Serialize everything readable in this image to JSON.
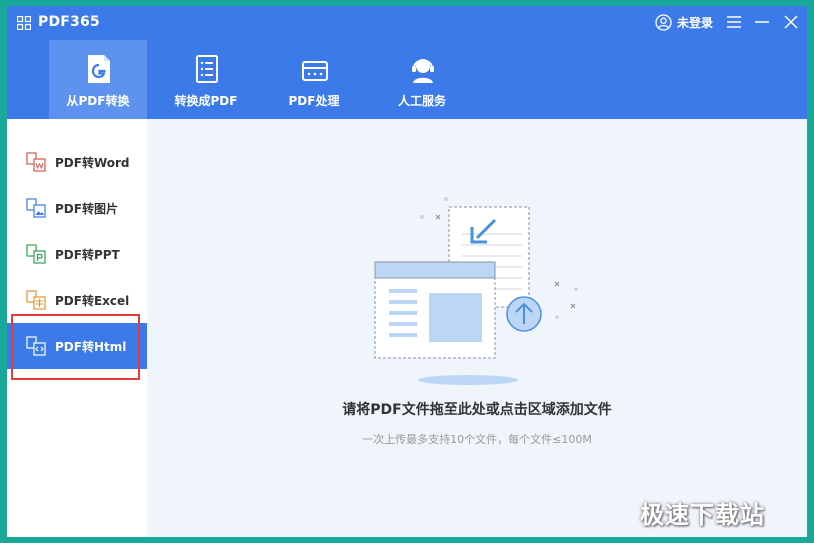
{
  "app": {
    "title": "PDF365",
    "user_label": "未登录"
  },
  "nav": {
    "tabs": [
      {
        "label": "从PDF转换",
        "icon": "pdf-file-icon",
        "active": true
      },
      {
        "label": "转换成PDF",
        "icon": "document-list-icon",
        "active": false
      },
      {
        "label": "PDF处理",
        "icon": "toolbox-icon",
        "active": false
      },
      {
        "label": "人工服务",
        "icon": "headset-icon",
        "active": false
      }
    ]
  },
  "sidebar": {
    "items": [
      {
        "label": "PDF转Word",
        "icon": "word-convert-icon",
        "color": "#d9534f"
      },
      {
        "label": "PDF转图片",
        "icon": "image-convert-icon",
        "color": "#3b7ae8"
      },
      {
        "label": "PDF转PPT",
        "icon": "ppt-convert-icon",
        "color": "#2ea44f"
      },
      {
        "label": "PDF转Excel",
        "icon": "excel-convert-icon",
        "color": "#e8912d"
      },
      {
        "label": "PDF转Html",
        "icon": "html-convert-icon",
        "color": "#ffffff",
        "active": true
      }
    ]
  },
  "main": {
    "drop_title": "请将PDF文件拖至此处或点击区域添加文件",
    "drop_hint": "一次上传最多支持10个文件，每个文件≤100M"
  },
  "watermark": "极速下载站",
  "colors": {
    "accent": "#3b7ae8",
    "active_tab": "#5d93ef",
    "content_bg": "#f0f4fb",
    "highlight": "#e43b3b"
  }
}
